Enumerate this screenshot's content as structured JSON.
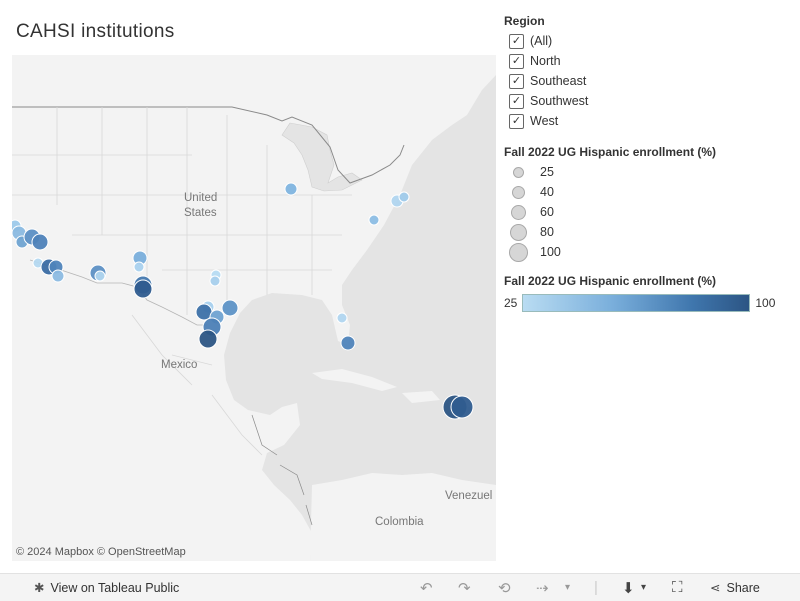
{
  "title": "CAHSI institutions",
  "map": {
    "labels": {
      "country_us_1": "United",
      "country_us_2": "States",
      "mexico": "Mexico",
      "colombia": "Colombia",
      "venezuela": "Venezuel"
    },
    "attribution": "© 2024 Mapbox  © OpenStreetMap"
  },
  "region_filter": {
    "title": "Region",
    "items": [
      {
        "label": "(All)",
        "checked": true
      },
      {
        "label": "North",
        "checked": true
      },
      {
        "label": "Southeast",
        "checked": true
      },
      {
        "label": "Southwest",
        "checked": true
      },
      {
        "label": "West",
        "checked": true
      }
    ]
  },
  "size_legend": {
    "title": "Fall 2022 UG Hispanic enrollment (%)",
    "items": [
      "25",
      "40",
      "60",
      "80",
      "100"
    ]
  },
  "color_legend": {
    "title": "Fall 2022 UG Hispanic enrollment (%)",
    "min": "25",
    "max": "100",
    "colors": [
      "#b9dcf2",
      "#2c5584"
    ]
  },
  "footer": {
    "view_label": "View on Tableau Public",
    "share_label": "Share"
  }
}
